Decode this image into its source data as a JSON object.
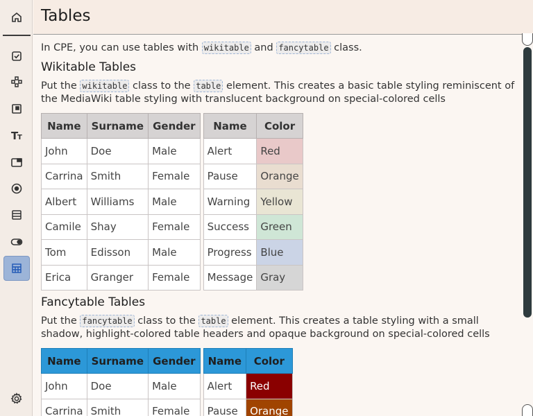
{
  "header": {
    "title": "Tables"
  },
  "intro": {
    "before": "In CPE, you can use tables with ",
    "code1": "wikitable",
    "middle": " and ",
    "code2": "fancytable",
    "after": " class."
  },
  "wiki_section": {
    "title": "Wikitable Tables",
    "desc_before": "Put the ",
    "desc_code1": "wikitable",
    "desc_middle": " class to the ",
    "desc_code2": "table",
    "desc_after": " element. This creates a basic table styling reminiscent of the MediaWiki table styling with translucent background on special-colored cells"
  },
  "fancy_section": {
    "title": "Fancytable Tables",
    "desc_before": "Put the ",
    "desc_code1": "fancytable",
    "desc_middle": " class to the ",
    "desc_code2": "table",
    "desc_after": " element. This creates a table styling with a small shadow, highlight-colored table headers and opaque background on special-colored cells"
  },
  "people_table": {
    "headers": [
      "Name",
      "Surname",
      "Gender"
    ],
    "rows": [
      [
        "John",
        "Doe",
        "Male"
      ],
      [
        "Carrina",
        "Smith",
        "Female"
      ],
      [
        "Albert",
        "Williams",
        "Male"
      ],
      [
        "Camile",
        "Shay",
        "Female"
      ],
      [
        "Tom",
        "Edisson",
        "Male"
      ],
      [
        "Erica",
        "Granger",
        "Female"
      ]
    ]
  },
  "color_table": {
    "headers": [
      "Name",
      "Color"
    ],
    "rows": [
      [
        "Alert",
        "Red"
      ],
      [
        "Pause",
        "Orange"
      ],
      [
        "Warning",
        "Yellow"
      ],
      [
        "Success",
        "Green"
      ],
      [
        "Progress",
        "Blue"
      ],
      [
        "Message",
        "Gray"
      ]
    ]
  },
  "colors": {
    "wiki_header": "#d6d3d3",
    "fancy_header": "#2c98d8",
    "red": "#8a0000",
    "orange": "#a04400",
    "active_sidebar": "#9cb4d8"
  },
  "sidebar": {
    "items": [
      "home-icon",
      "checkbox-icon",
      "components-icon",
      "frame-icon",
      "typography-icon",
      "window-icon",
      "radio-icon",
      "list-icon",
      "toggle-icon",
      "table-icon",
      "settings-icon"
    ]
  }
}
